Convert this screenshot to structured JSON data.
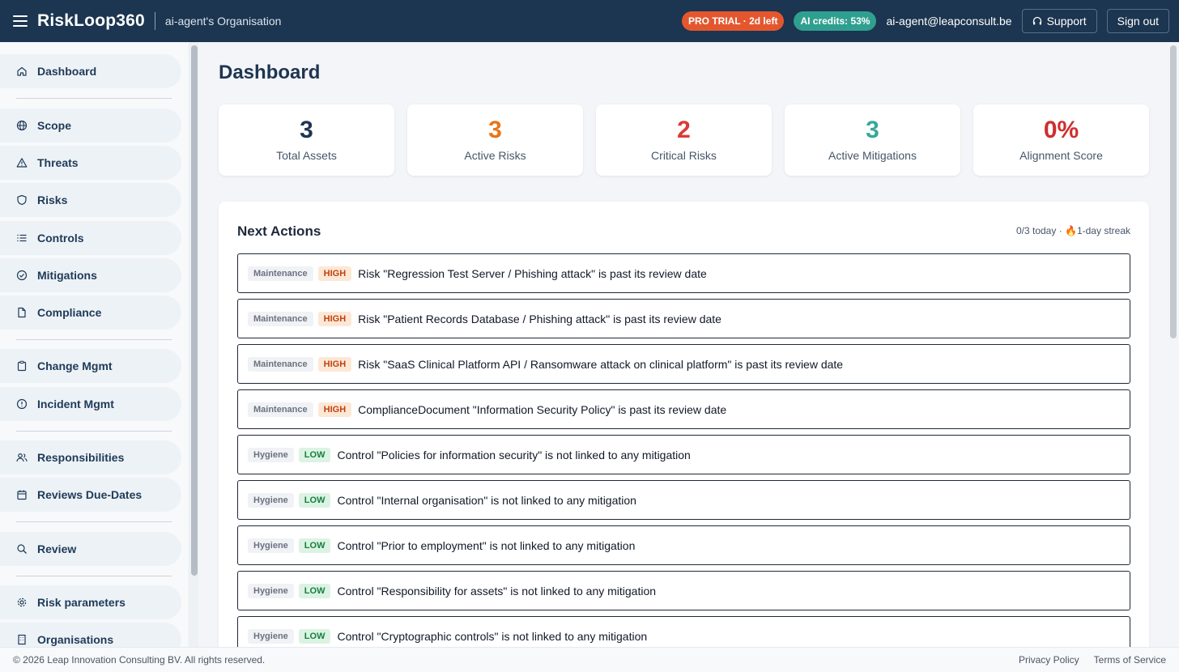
{
  "header": {
    "brand": "RiskLoop360",
    "organisation": "ai-agent's Organisation",
    "trial_badge": "PRO TRIAL · 2d left",
    "credits_badge": "AI credits: 53%",
    "user_email": "ai-agent@leapconsult.be",
    "support_label": "Support",
    "signout_label": "Sign out"
  },
  "sidebar": {
    "items": [
      {
        "label": "Dashboard",
        "icon": "home-icon"
      },
      {
        "label": "Scope",
        "icon": "globe-icon"
      },
      {
        "label": "Threats",
        "icon": "warning-icon"
      },
      {
        "label": "Risks",
        "icon": "shield-icon"
      },
      {
        "label": "Controls",
        "icon": "list-icon"
      },
      {
        "label": "Mitigations",
        "icon": "check-circle-icon"
      },
      {
        "label": "Compliance",
        "icon": "document-icon"
      },
      {
        "label": "Change Mgmt",
        "icon": "clipboard-icon"
      },
      {
        "label": "Incident Mgmt",
        "icon": "alert-circle-icon"
      },
      {
        "label": "Responsibilities",
        "icon": "users-icon"
      },
      {
        "label": "Reviews Due-Dates",
        "icon": "calendar-icon"
      },
      {
        "label": "Review",
        "icon": "search-icon"
      },
      {
        "label": "Risk parameters",
        "icon": "gear-icon"
      },
      {
        "label": "Organisations",
        "icon": "building-icon"
      }
    ]
  },
  "page": {
    "title": "Dashboard"
  },
  "stats": [
    {
      "value": "3",
      "label": "Total Assets",
      "color": "#1e3550"
    },
    {
      "value": "3",
      "label": "Active Risks",
      "color": "#ea7317"
    },
    {
      "value": "2",
      "label": "Critical Risks",
      "color": "#dc3b35"
    },
    {
      "value": "3",
      "label": "Active Mitigations",
      "color": "#37a89a"
    },
    {
      "value": "0%",
      "label": "Alignment Score",
      "color": "#cf2e2e"
    }
  ],
  "next_actions": {
    "title": "Next Actions",
    "meta": "0/3 today · 🔥1-day streak",
    "items": [
      {
        "category": "Maintenance",
        "severity": "HIGH",
        "text": "Risk \"Regression Test Server / Phishing attack\" is past its review date"
      },
      {
        "category": "Maintenance",
        "severity": "HIGH",
        "text": "Risk \"Patient Records Database / Phishing attack\" is past its review date"
      },
      {
        "category": "Maintenance",
        "severity": "HIGH",
        "text": "Risk \"SaaS Clinical Platform API / Ransomware attack on clinical platform\" is past its review date"
      },
      {
        "category": "Maintenance",
        "severity": "HIGH",
        "text": "ComplianceDocument \"Information Security Policy\" is past its review date"
      },
      {
        "category": "Hygiene",
        "severity": "LOW",
        "text": "Control \"Policies for information security\" is not linked to any mitigation"
      },
      {
        "category": "Hygiene",
        "severity": "LOW",
        "text": "Control \"Internal organisation\" is not linked to any mitigation"
      },
      {
        "category": "Hygiene",
        "severity": "LOW",
        "text": "Control \"Prior to employment\" is not linked to any mitigation"
      },
      {
        "category": "Hygiene",
        "severity": "LOW",
        "text": "Control \"Responsibility for assets\" is not linked to any mitigation"
      },
      {
        "category": "Hygiene",
        "severity": "LOW",
        "text": "Control \"Cryptographic controls\" is not linked to any mitigation"
      }
    ]
  },
  "footer": {
    "copyright": "© 2026 Leap Innovation Consulting BV. All rights reserved.",
    "privacy": "Privacy Policy",
    "terms": "Terms of Service"
  }
}
